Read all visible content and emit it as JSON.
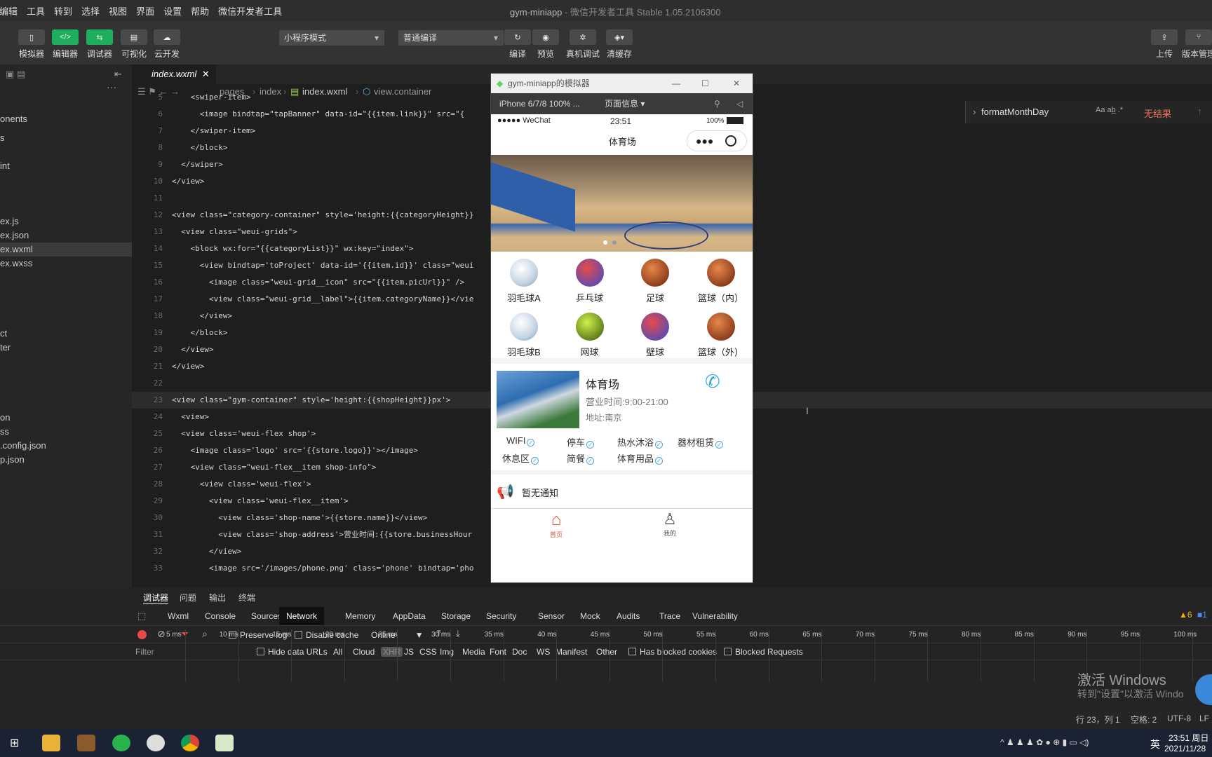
{
  "menu": [
    "编辑",
    "工具",
    "转到",
    "选择",
    "视图",
    "界面",
    "设置",
    "帮助",
    "微信开发者工具"
  ],
  "window_title": "gym-miniapp",
  "window_sub": " - 微信开发者工具 Stable 1.05.2106300",
  "toolbar": {
    "simulator": "模拟器",
    "editor": "编辑器",
    "debugger": "调试器",
    "visual": "可视化",
    "cloud": "云开发",
    "mode": "小程序模式",
    "compile_mode": "普通编译",
    "compile": "编译",
    "preview": "预览",
    "remote_debug": "真机调试",
    "clear_cache": "清缓存",
    "upload": "上传",
    "version": "版本管理"
  },
  "sidebar": {
    "files": [
      "onents",
      "s",
      "int",
      "ex.js",
      "ex.json",
      "ex.wxml",
      "ex.wxss",
      "ct",
      "ter",
      "on",
      "ss",
      ".config.json",
      "p.json"
    ]
  },
  "editor": {
    "tab": "index.wxml",
    "crumbs": [
      "pages",
      "index",
      "index.wxml",
      "view.container"
    ],
    "lines": [
      {
        "n": "5",
        "t": "    <swiper-item>"
      },
      {
        "n": "6",
        "t": "      <image bindtap=\"tapBanner\" data-id=\"{{item.link}}\" src=\"{"
      },
      {
        "n": "7",
        "t": "    </swiper-item>"
      },
      {
        "n": "8",
        "t": "    </block>"
      },
      {
        "n": "9",
        "t": "  </swiper>"
      },
      {
        "n": "10",
        "t": "</view>"
      },
      {
        "n": "11",
        "t": ""
      },
      {
        "n": "12",
        "t": "<view class=\"category-container\" style='height:{{categoryHeight}}"
      },
      {
        "n": "13",
        "t": "  <view class=\"weui-grids\">"
      },
      {
        "n": "14",
        "t": "    <block wx:for=\"{{categoryList}}\" wx:key=\"index\">"
      },
      {
        "n": "15",
        "t": "      <view bindtap='toProject' data-id='{{item.id}}' class=\"weui"
      },
      {
        "n": "16",
        "t": "        <image class=\"weui-grid__icon\" src=\"{{item.picUrl}}\" />"
      },
      {
        "n": "17",
        "t": "        <view class=\"weui-grid__label\">{{item.categoryName}}</vie"
      },
      {
        "n": "18",
        "t": "      </view>"
      },
      {
        "n": "19",
        "t": "    </block>"
      },
      {
        "n": "20",
        "t": "  </view>"
      },
      {
        "n": "21",
        "t": "</view>"
      },
      {
        "n": "22",
        "t": ""
      },
      {
        "n": "23",
        "t": "<view class=\"gym-container\" style='height:{{shopHeight}}px'>"
      },
      {
        "n": "24",
        "t": "  <view>"
      },
      {
        "n": "25",
        "t": "  <view class='weui-flex shop'>"
      },
      {
        "n": "26",
        "t": "    <image class='logo' src='{{store.logo}}'></image>"
      },
      {
        "n": "27",
        "t": "    <view class=\"weui-flex__item shop-info\">"
      },
      {
        "n": "28",
        "t": "      <view class='weui-flex'>"
      },
      {
        "n": "29",
        "t": "        <view class='weui-flex__item'>"
      },
      {
        "n": "30",
        "t": "          <view class='shop-name'>{{store.name}}</view>"
      },
      {
        "n": "31",
        "t": "          <view class='shop-address'>营业时间:{{store.businessHour"
      },
      {
        "n": "32",
        "t": "        </view>"
      },
      {
        "n": "33",
        "t": "        <image src='/images/phone.png' class='phone' bindtap='pho"
      }
    ]
  },
  "find": {
    "query": "formatMonthDay",
    "result": "无结果"
  },
  "sim": {
    "title": "gym-miniapp的模拟器",
    "device": "iPhone 6/7/8 100% ...",
    "page_info": "页面信息",
    "carrier": "●●●●● WeChat",
    "time": "23:51",
    "battery": "100%",
    "nav_title": "体育场",
    "categories": [
      "羽毛球A",
      "乒乓球",
      "足球",
      "篮球（内）",
      "羽毛球B",
      "网球",
      "壁球",
      "篮球（外）"
    ],
    "shop": {
      "name": "体育场",
      "hours": "营业时间:9:00-21:00",
      "address": "地址:南京"
    },
    "facilities": [
      "WIFI",
      "停车",
      "热水沐浴",
      "器材租赁",
      "休息区",
      "简餐",
      "体育用品"
    ],
    "notice": "暂无通知",
    "tab_home": "首页",
    "tab_mine": "我的"
  },
  "devtools": {
    "top_tabs": [
      "调试器",
      "问题",
      "输出",
      "终端"
    ],
    "tabs": [
      "Wxml",
      "Console",
      "Sources",
      "Network",
      "Memory",
      "AppData",
      "Storage",
      "Security",
      "Sensor",
      "Mock",
      "Audits",
      "Trace",
      "Vulnerability"
    ],
    "preserve_log": "Preserve log",
    "disable_cache": "Disable cache",
    "throttle": "Online",
    "filter": "Filter",
    "hide_data": "Hide data URLs",
    "types": [
      "All",
      "Cloud",
      "XHR",
      "JS",
      "CSS",
      "Img",
      "Media",
      "Font",
      "Doc",
      "WS",
      "Manifest",
      "Other"
    ],
    "blocked_cookies": "Has blocked cookies",
    "blocked_requests": "Blocked Requests",
    "ticks": [
      "5 ms",
      "10 ms",
      "15 ms",
      "20 ms",
      "25 ms",
      "30 ms",
      "35 ms",
      "40 ms",
      "45 ms",
      "50 ms",
      "55 ms",
      "60 ms",
      "65 ms",
      "70 ms",
      "75 ms",
      "80 ms",
      "85 ms",
      "90 ms",
      "95 ms",
      "100 ms"
    ],
    "warnings": "6",
    "infos": "1"
  },
  "watermark": {
    "line1": "激活 Windows",
    "line2": "转到\"设置\"以激活 Windo"
  },
  "status": {
    "pos": "行 23，列 1",
    "spaces": "空格: 2",
    "enc": "UTF-8",
    "eol": "LF"
  },
  "taskbar": {
    "time": "23:51 周日",
    "date": "2021/11/28",
    "ime": "英"
  }
}
